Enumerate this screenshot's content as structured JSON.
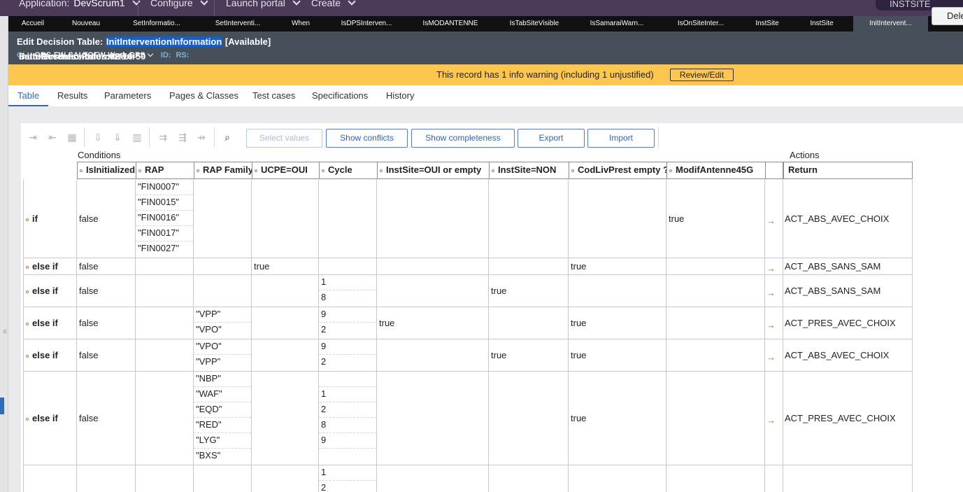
{
  "topbar": {
    "application_label": "Application:",
    "application_name": "DevScrum1",
    "configure": "Configure",
    "launch_portal": "Launch portal",
    "create": "Create",
    "instsite": "INSTSITE"
  },
  "tabs": [
    "Accueil",
    "Nouveau",
    "SetInformatio...",
    "SetInterventi...",
    "When",
    "IsDPSInterven...",
    "IsMODANTENNE",
    "IsTabSiteVisible",
    "IsSamaraiWarn...",
    "IsOnSiteInter...",
    "InstSite",
    "InstSite",
    "InitIntervent..."
  ],
  "header": {
    "edit_prefix": "Edit  Decision Table: ",
    "rule_name": "InitInterventionInformation",
    "status": " [Available]",
    "cl_key": "CL:",
    "cl_value": "OBS-FW-SALTOFW-Work-DPS",
    "id_key": "ID:",
    "id_value": "InitInterventionInformation",
    "rs_key": "RS:",
    "rs_value": "SaltoBusinessRules:02-16-50",
    "delete_label": "Dele"
  },
  "warning": {
    "message": "This record has 1 info warning (including 1 unjustified)",
    "review_label": "Review/Edit"
  },
  "subtabs": [
    "Table",
    "Results",
    "Parameters",
    "Pages & Classes",
    "Test cases",
    "Specifications",
    "History"
  ],
  "toolbar": {
    "select_values": "Select values",
    "show_conflicts": "Show conflicts",
    "show_completeness": "Show completeness",
    "export": "Export",
    "import": "Import"
  },
  "table": {
    "conditions_label": "Conditions",
    "actions_label": "Actions",
    "columns": [
      "IsInitialized",
      "RAP",
      "RAP Family",
      "UCPE=OUI",
      "Cycle",
      "InstSite=OUI or empty",
      "InstSite=NON",
      "CodLivPrest empty ?",
      "ModifAntenne45G"
    ],
    "return_header": "Return",
    "rows": [
      {
        "label": "if",
        "cells": [
          [
            "false"
          ],
          [
            "\"FIN0007\"",
            "\"FIN0015\"",
            "\"FIN0016\"",
            "\"FIN0017\"",
            "\"FIN0027\""
          ],
          [],
          [],
          [],
          [],
          [],
          [],
          [
            "true"
          ]
        ],
        "result": "ACT_ABS_AVEC_CHOIX"
      },
      {
        "label": "else if",
        "cells": [
          [
            "false"
          ],
          [],
          [],
          [
            "true"
          ],
          [],
          [],
          [],
          [
            "true"
          ],
          []
        ],
        "result": "ACT_ABS_SANS_SAM"
      },
      {
        "label": "else if",
        "cells": [
          [
            "false"
          ],
          [],
          [],
          [],
          [
            "1",
            "8"
          ],
          [],
          [
            "true"
          ],
          [],
          []
        ],
        "result": "ACT_ABS_SANS_SAM"
      },
      {
        "label": "else if",
        "cells": [
          [
            "false"
          ],
          [],
          [
            "\"VPP\"",
            "\"VPO\""
          ],
          [],
          [
            "9",
            "2"
          ],
          [
            "true"
          ],
          [],
          [
            "true"
          ],
          []
        ],
        "result": "ACT_PRES_AVEC_CHOIX"
      },
      {
        "label": "else if",
        "cells": [
          [
            "false"
          ],
          [],
          [
            "\"VPO\"",
            "\"VPP\""
          ],
          [],
          [
            "9",
            "2"
          ],
          [],
          [
            "true"
          ],
          [
            "true"
          ],
          []
        ],
        "result": "ACT_ABS_AVEC_CHOIX"
      },
      {
        "label": "else if",
        "cells": [
          [
            "false"
          ],
          [],
          [
            "\"NBP\"",
            "\"WAF\"",
            "\"EQD\"",
            "\"RED\"",
            "\"LYG\"",
            "\"BXS\""
          ],
          [],
          [
            "",
            "1",
            "2",
            "8",
            "9",
            ""
          ],
          [],
          [],
          [
            "true"
          ],
          []
        ],
        "result": "ACT_PRES_AVEC_CHOIX"
      },
      {
        "label": "",
        "cells": [
          [],
          [],
          [],
          [],
          [
            "1",
            "2"
          ],
          [],
          [],
          [],
          []
        ],
        "result": ""
      }
    ]
  }
}
